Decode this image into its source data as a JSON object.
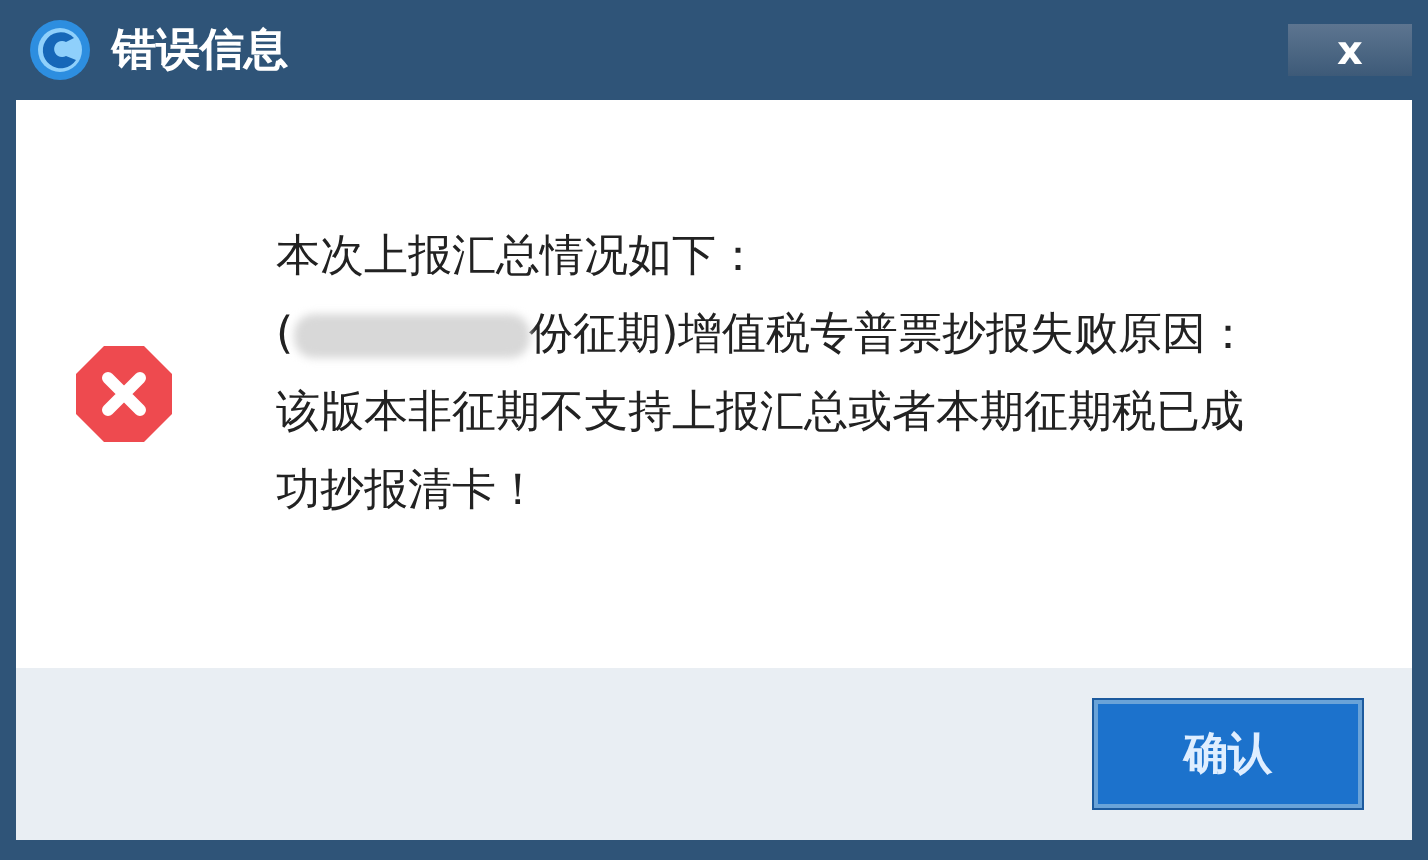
{
  "window": {
    "title": "错误信息",
    "close": "x"
  },
  "message": {
    "lines": [
      {
        "kind": "text",
        "text": "本次上报汇总情况如下："
      },
      {
        "kind": "redacted",
        "prefix": "(",
        "suffix": "份征期)增值税专普票抄报失败原因："
      },
      {
        "kind": "text",
        "text": "该版本非征期不支持上报汇总或者本期征期税已成"
      },
      {
        "kind": "text",
        "text": "功抄报清卡！"
      }
    ]
  },
  "buttons": [
    "确认"
  ]
}
